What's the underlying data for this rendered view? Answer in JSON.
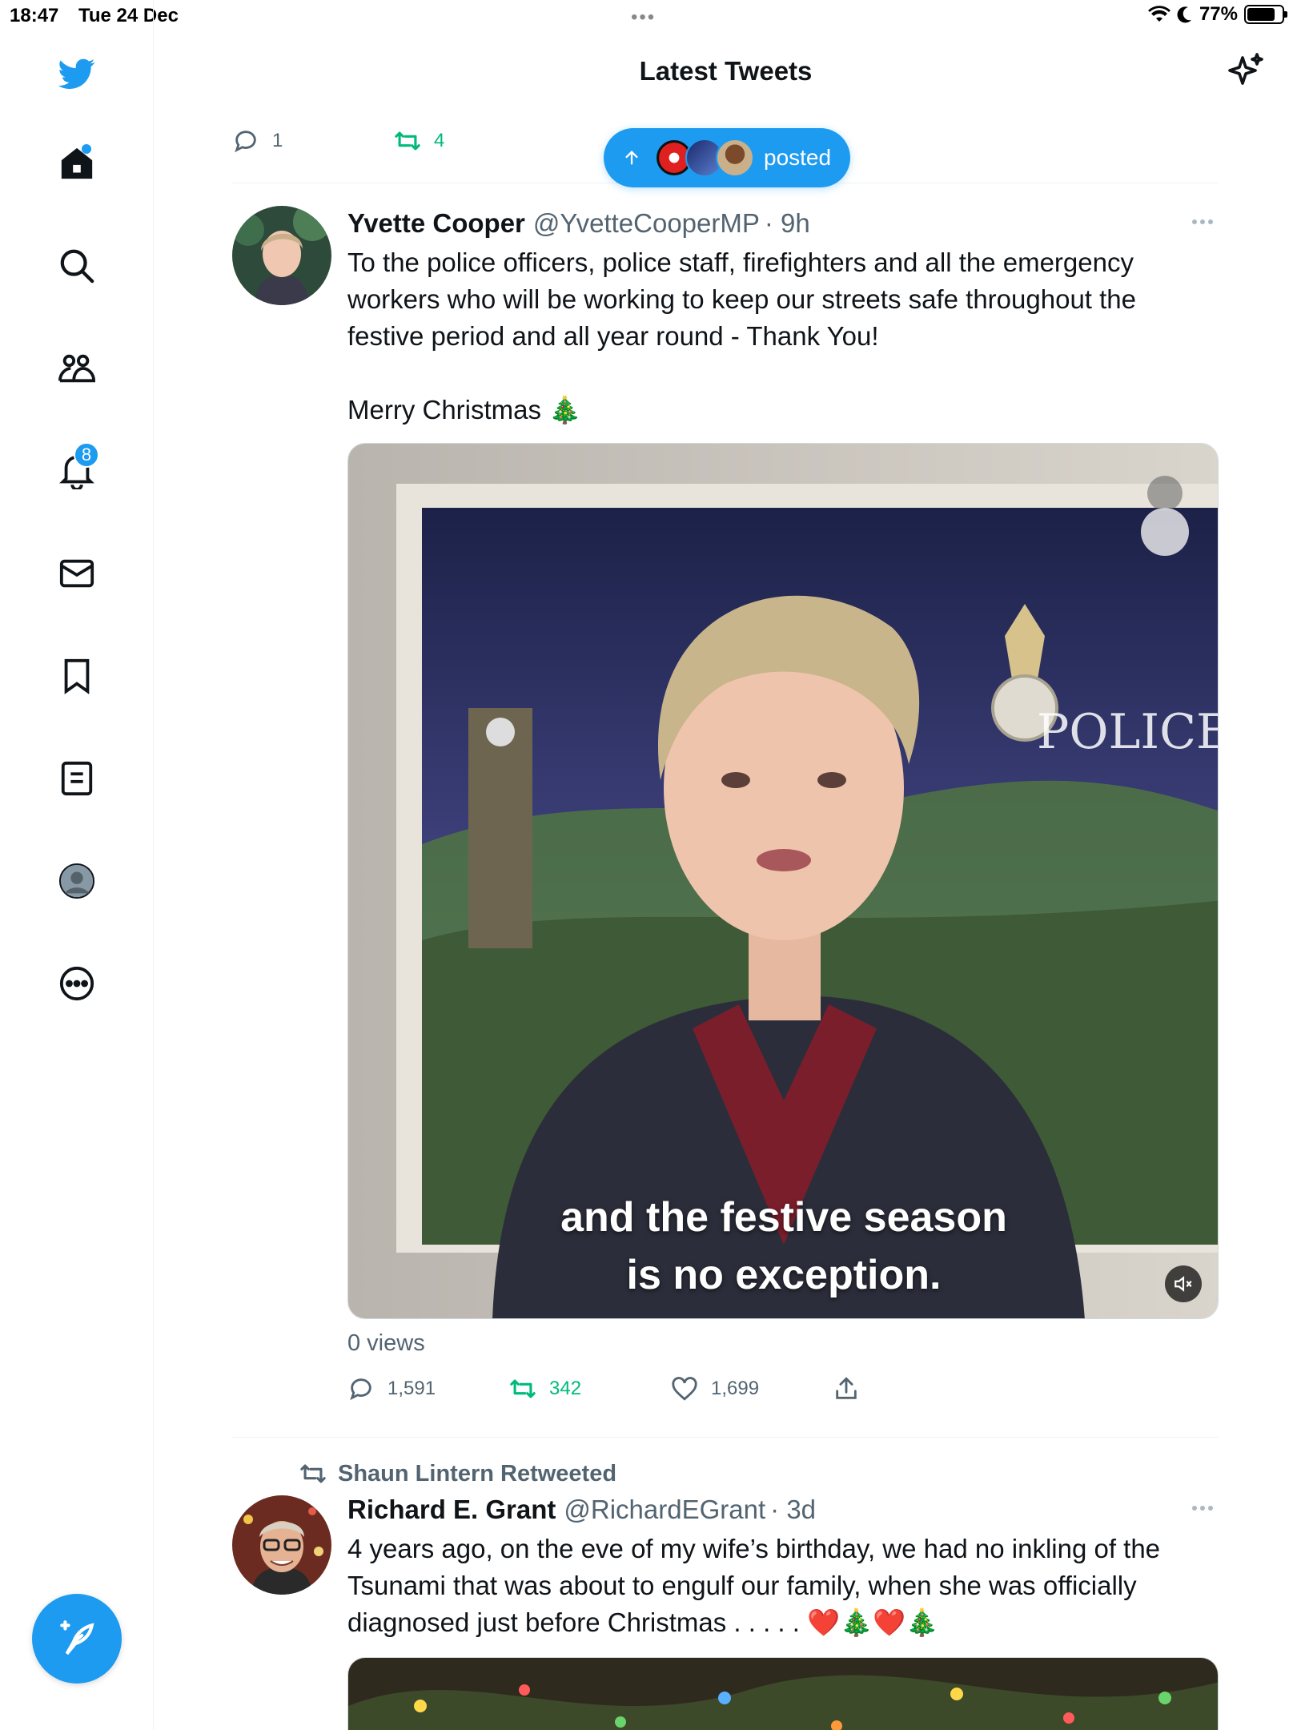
{
  "status_bar": {
    "time": "18:47",
    "date": "Tue 24 Dec",
    "battery": "77%"
  },
  "header": {
    "title": "Latest Tweets"
  },
  "sidebar": {
    "notifications_badge": "8"
  },
  "new_tweets_pill": {
    "label": "posted"
  },
  "prev_tweet": {
    "replies": "1",
    "retweets": "4"
  },
  "tweet1": {
    "name": "Yvette Cooper",
    "handle": "@YvetteCooperMP",
    "time": "· 9h",
    "text": "To the police officers, police staff, firefighters and all the emergency workers who will be working to keep our streets safe throughout the festive period and all year round - Thank You!\n\nMerry Christmas 🎄",
    "caption_line1": "and the festive season",
    "caption_line2": "is no exception.",
    "views": "0 views",
    "replies": "1,591",
    "retweets": "342",
    "likes": "1,699"
  },
  "tweet2": {
    "retweeted_by": "Shaun Lintern Retweeted",
    "name": "Richard E. Grant",
    "handle": "@RichardEGrant",
    "time": "· 3d",
    "text": "4 years ago, on the eve of my wife’s birthday, we had no inkling of the Tsunami that was about to engulf our family, when she was officially diagnosed  just before Christmas  . . . . . ❤️🎄❤️🎄"
  },
  "colors": {
    "accent": "#1d9bf0",
    "retweet": "#00ba7c",
    "muted": "#536471"
  }
}
